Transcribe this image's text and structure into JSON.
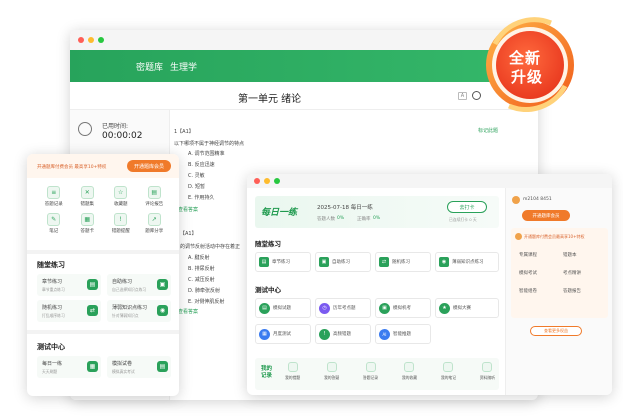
{
  "back_window": {
    "brand": "密题库",
    "subject": "生理学",
    "unit_title": "第一单元 绪论",
    "timer_label": "已用时间:",
    "timer_value": "00:00:02",
    "q1_tag": "1【A1】",
    "q1_text": "以下哪项不属于神经调节的特点",
    "q1_options": [
      "A. 调节范围精准",
      "B. 反应迅速",
      "C. 灵敏",
      "D. 短暂",
      "E. 作用持久"
    ],
    "view_answer": "查看答案",
    "q2_tag": "【A1】",
    "q2_text": "的调节反射活动中存在着正",
    "q2_options": [
      "A. 腱反射",
      "B. 排尿反射",
      "C. 减压反射",
      "D. 肺牵张反射",
      "E. 对侧伸肌反射"
    ],
    "right_link": "标记此题"
  },
  "badge": {
    "line1": "全新",
    "line2": "升级"
  },
  "mobile_card": {
    "vip_text": "开通题库付费会员 最高享10+特权",
    "vip_button": "开通题库会员",
    "grid": [
      {
        "label": "答题记录",
        "icon": "≡"
      },
      {
        "label": "错题集",
        "icon": "✕"
      },
      {
        "label": "收藏题",
        "icon": "☆"
      },
      {
        "label": "评论报告",
        "icon": "▤"
      },
      {
        "label": "笔记",
        "icon": "✎"
      },
      {
        "label": "答题卡",
        "icon": "▦"
      },
      {
        "label": "错题提醒",
        "icon": "!"
      },
      {
        "label": "题库分享",
        "icon": "↗"
      }
    ],
    "section1": "随堂练习",
    "practice": [
      {
        "title": "章节练习",
        "desc": "章节重点练习",
        "icon": "▤"
      },
      {
        "title": "自助练习",
        "desc": "自己选择知识点练习",
        "icon": "▣"
      },
      {
        "title": "随机练习",
        "desc": "打乱顺序练习",
        "icon": "⇄"
      },
      {
        "title": "薄弱知识点练习",
        "desc": "针对薄弱知识点",
        "icon": "◉"
      }
    ],
    "section2": "测试中心",
    "tests": [
      {
        "title": "每日一练",
        "desc": "天天刷题",
        "icon": "▦"
      },
      {
        "title": "模拟试卷",
        "desc": "模拟真实考试",
        "icon": "▤"
      }
    ]
  },
  "front_window": {
    "daily_title": "每日一练",
    "daily_date": "2025-07-18 每日一练",
    "stat1_label": "答题人数",
    "stat1_value": "0%",
    "stat2_label": "正确率",
    "stat2_value": "0%",
    "checkin_button": "去打卡",
    "checkin_sub": "已连续打卡 0 天",
    "section1": "随堂练习",
    "practice": [
      {
        "label": "章节练习",
        "icon": "▤"
      },
      {
        "label": "自助练习",
        "icon": "▣"
      },
      {
        "label": "随机练习",
        "icon": "⇄"
      },
      {
        "label": "薄弱知识点练习",
        "icon": "◉"
      }
    ],
    "section2": "测试中心",
    "tests": [
      {
        "label": "模拟试题",
        "icon": "▤"
      },
      {
        "label": "历年考点题",
        "icon": "◷"
      },
      {
        "label": "模拟机考",
        "icon": "▣"
      },
      {
        "label": "模拟大赛",
        "icon": "★"
      },
      {
        "label": "月度测试",
        "icon": "▦"
      },
      {
        "label": "高频错题",
        "icon": "!"
      },
      {
        "label": "智能推题",
        "icon": "AI"
      }
    ],
    "records_title": "我的记录",
    "records": [
      "我的错题",
      "我的答疑",
      "答题记录",
      "我的收藏",
      "我的笔记",
      "资料随听"
    ],
    "right_user": "m2104 8451",
    "right_vip_button": "开通题库会员",
    "right_promo": "开通题库付费会员最高享10+特权",
    "right_features": [
      "专属课程",
      "错题本",
      "模拟考试",
      "考点精讲",
      "智能组卷",
      "答题报告"
    ],
    "right_more": "查看更多权益"
  }
}
